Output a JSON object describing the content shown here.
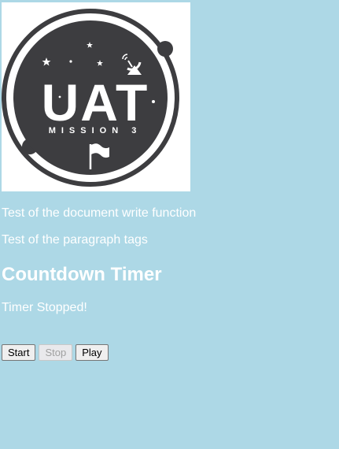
{
  "logo": {
    "main_text": "UAT",
    "sub_text": "MISSION 3",
    "colors": {
      "background": "#ffffff",
      "badge": "#3d3d40",
      "ink": "#ffffff"
    }
  },
  "content": {
    "document_write_text": "Test of the document write function",
    "paragraph_text": "Test of the paragraph tags",
    "heading": "Countdown Timer",
    "timer_status": "Timer Stopped!"
  },
  "controls": {
    "start_label": "Start",
    "stop_label": "Stop",
    "play_label": "Play"
  },
  "colors": {
    "page_background": "#add8e6",
    "text": "#ffffff"
  }
}
